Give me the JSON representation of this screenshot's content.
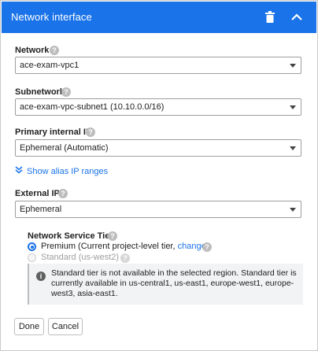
{
  "header": {
    "title": "Network interface",
    "delete_icon": "trash-icon",
    "collapse_icon": "chevron-up-icon",
    "background_color": "#1a73e8"
  },
  "network": {
    "label": "Network",
    "value": "ace-exam-vpc1"
  },
  "subnetwork": {
    "label": "Subnetwork",
    "value": "ace-exam-vpc-subnet1 (10.10.0.0/16)"
  },
  "primary_ip": {
    "label": "Primary internal IP",
    "value": "Ephemeral (Automatic)"
  },
  "alias_link": {
    "label": "Show alias IP ranges",
    "icon": "double-chevron-down-icon"
  },
  "external_ip": {
    "label": "External IP",
    "value": "Ephemeral"
  },
  "tier": {
    "label": "Network Service Tier",
    "premium_label": "Premium (Current project-level tier, ",
    "premium_link": "change",
    "premium_suffix": ")",
    "premium_selected": true,
    "standard_label": "Standard (us-west2)",
    "standard_disabled": true
  },
  "info": {
    "icon": "info-icon",
    "text": "Standard tier is not available in the selected region. Standard tier is currently available in us-central1, us-east1, europe-west1, europe-west3, asia-east1."
  },
  "buttons": {
    "done": "Done",
    "cancel": "Cancel"
  },
  "help_glyph": "?",
  "info_glyph": "i"
}
